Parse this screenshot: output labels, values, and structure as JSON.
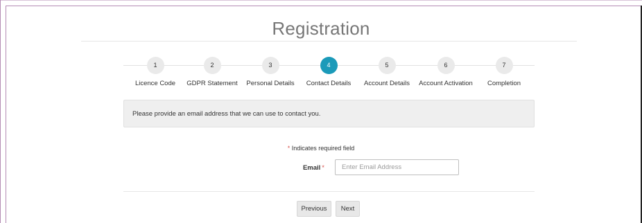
{
  "page": {
    "title": "Registration"
  },
  "steps": [
    {
      "number": "1",
      "label": "Licence Code"
    },
    {
      "number": "2",
      "label": "GDPR Statement"
    },
    {
      "number": "3",
      "label": "Personal Details"
    },
    {
      "number": "4",
      "label": "Contact Details",
      "active": true
    },
    {
      "number": "5",
      "label": "Account Details"
    },
    {
      "number": "6",
      "label": "Account Activation"
    },
    {
      "number": "7",
      "label": "Completion"
    }
  ],
  "info": {
    "message": "Please provide an email address that we can use to contact you."
  },
  "form": {
    "required_star": "*",
    "required_note": "Indicates required field",
    "email_label": "Email",
    "email_value": "",
    "email_placeholder": "Enter Email Address"
  },
  "buttons": {
    "previous": "Previous",
    "next": "Next"
  },
  "colors": {
    "active_step": "#1b9ab9",
    "required": "#d9534f"
  }
}
